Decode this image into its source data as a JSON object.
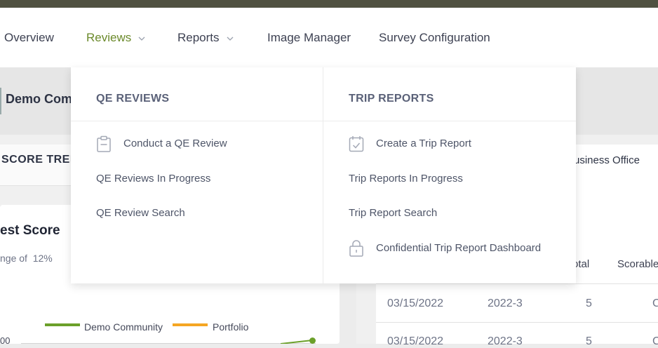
{
  "nav": {
    "items": [
      {
        "label": "Overview"
      },
      {
        "label": "Reviews"
      },
      {
        "label": "Reports"
      },
      {
        "label": "Image Manager"
      },
      {
        "label": "Survey Configuration"
      }
    ]
  },
  "dropdown": {
    "qe_reviews": {
      "header": "QE REVIEWS",
      "links": [
        "Conduct a QE Review",
        "QE Reviews In Progress",
        "QE Review Search"
      ]
    },
    "trip_reports": {
      "header": "TRIP REPORTS",
      "links": [
        "Create a Trip Report",
        "Trip Reports In Progress",
        "Trip Report Search",
        "Confidential Trip Report Dashboard"
      ]
    }
  },
  "background": {
    "community": "Demo Com",
    "score_trend": "SCORE TREN",
    "best_score": "est Score",
    "change_label": "nge of",
    "change_value": "12%",
    "legend": {
      "series1": "Demo Community",
      "series2": "Portfolio",
      "series1_color": "#6ba02a",
      "series2_color": "#f5a623"
    },
    "tick": "00",
    "business_office": "usiness Office",
    "table": {
      "headers": [
        "otal",
        "Scorable"
      ],
      "rows": [
        {
          "date": "03/15/2022",
          "period": "2022-3",
          "total": "5",
          "scorable": "C"
        },
        {
          "date": "03/15/2022",
          "period": "2022-3",
          "total": "5",
          "scorable": "C"
        }
      ]
    }
  }
}
